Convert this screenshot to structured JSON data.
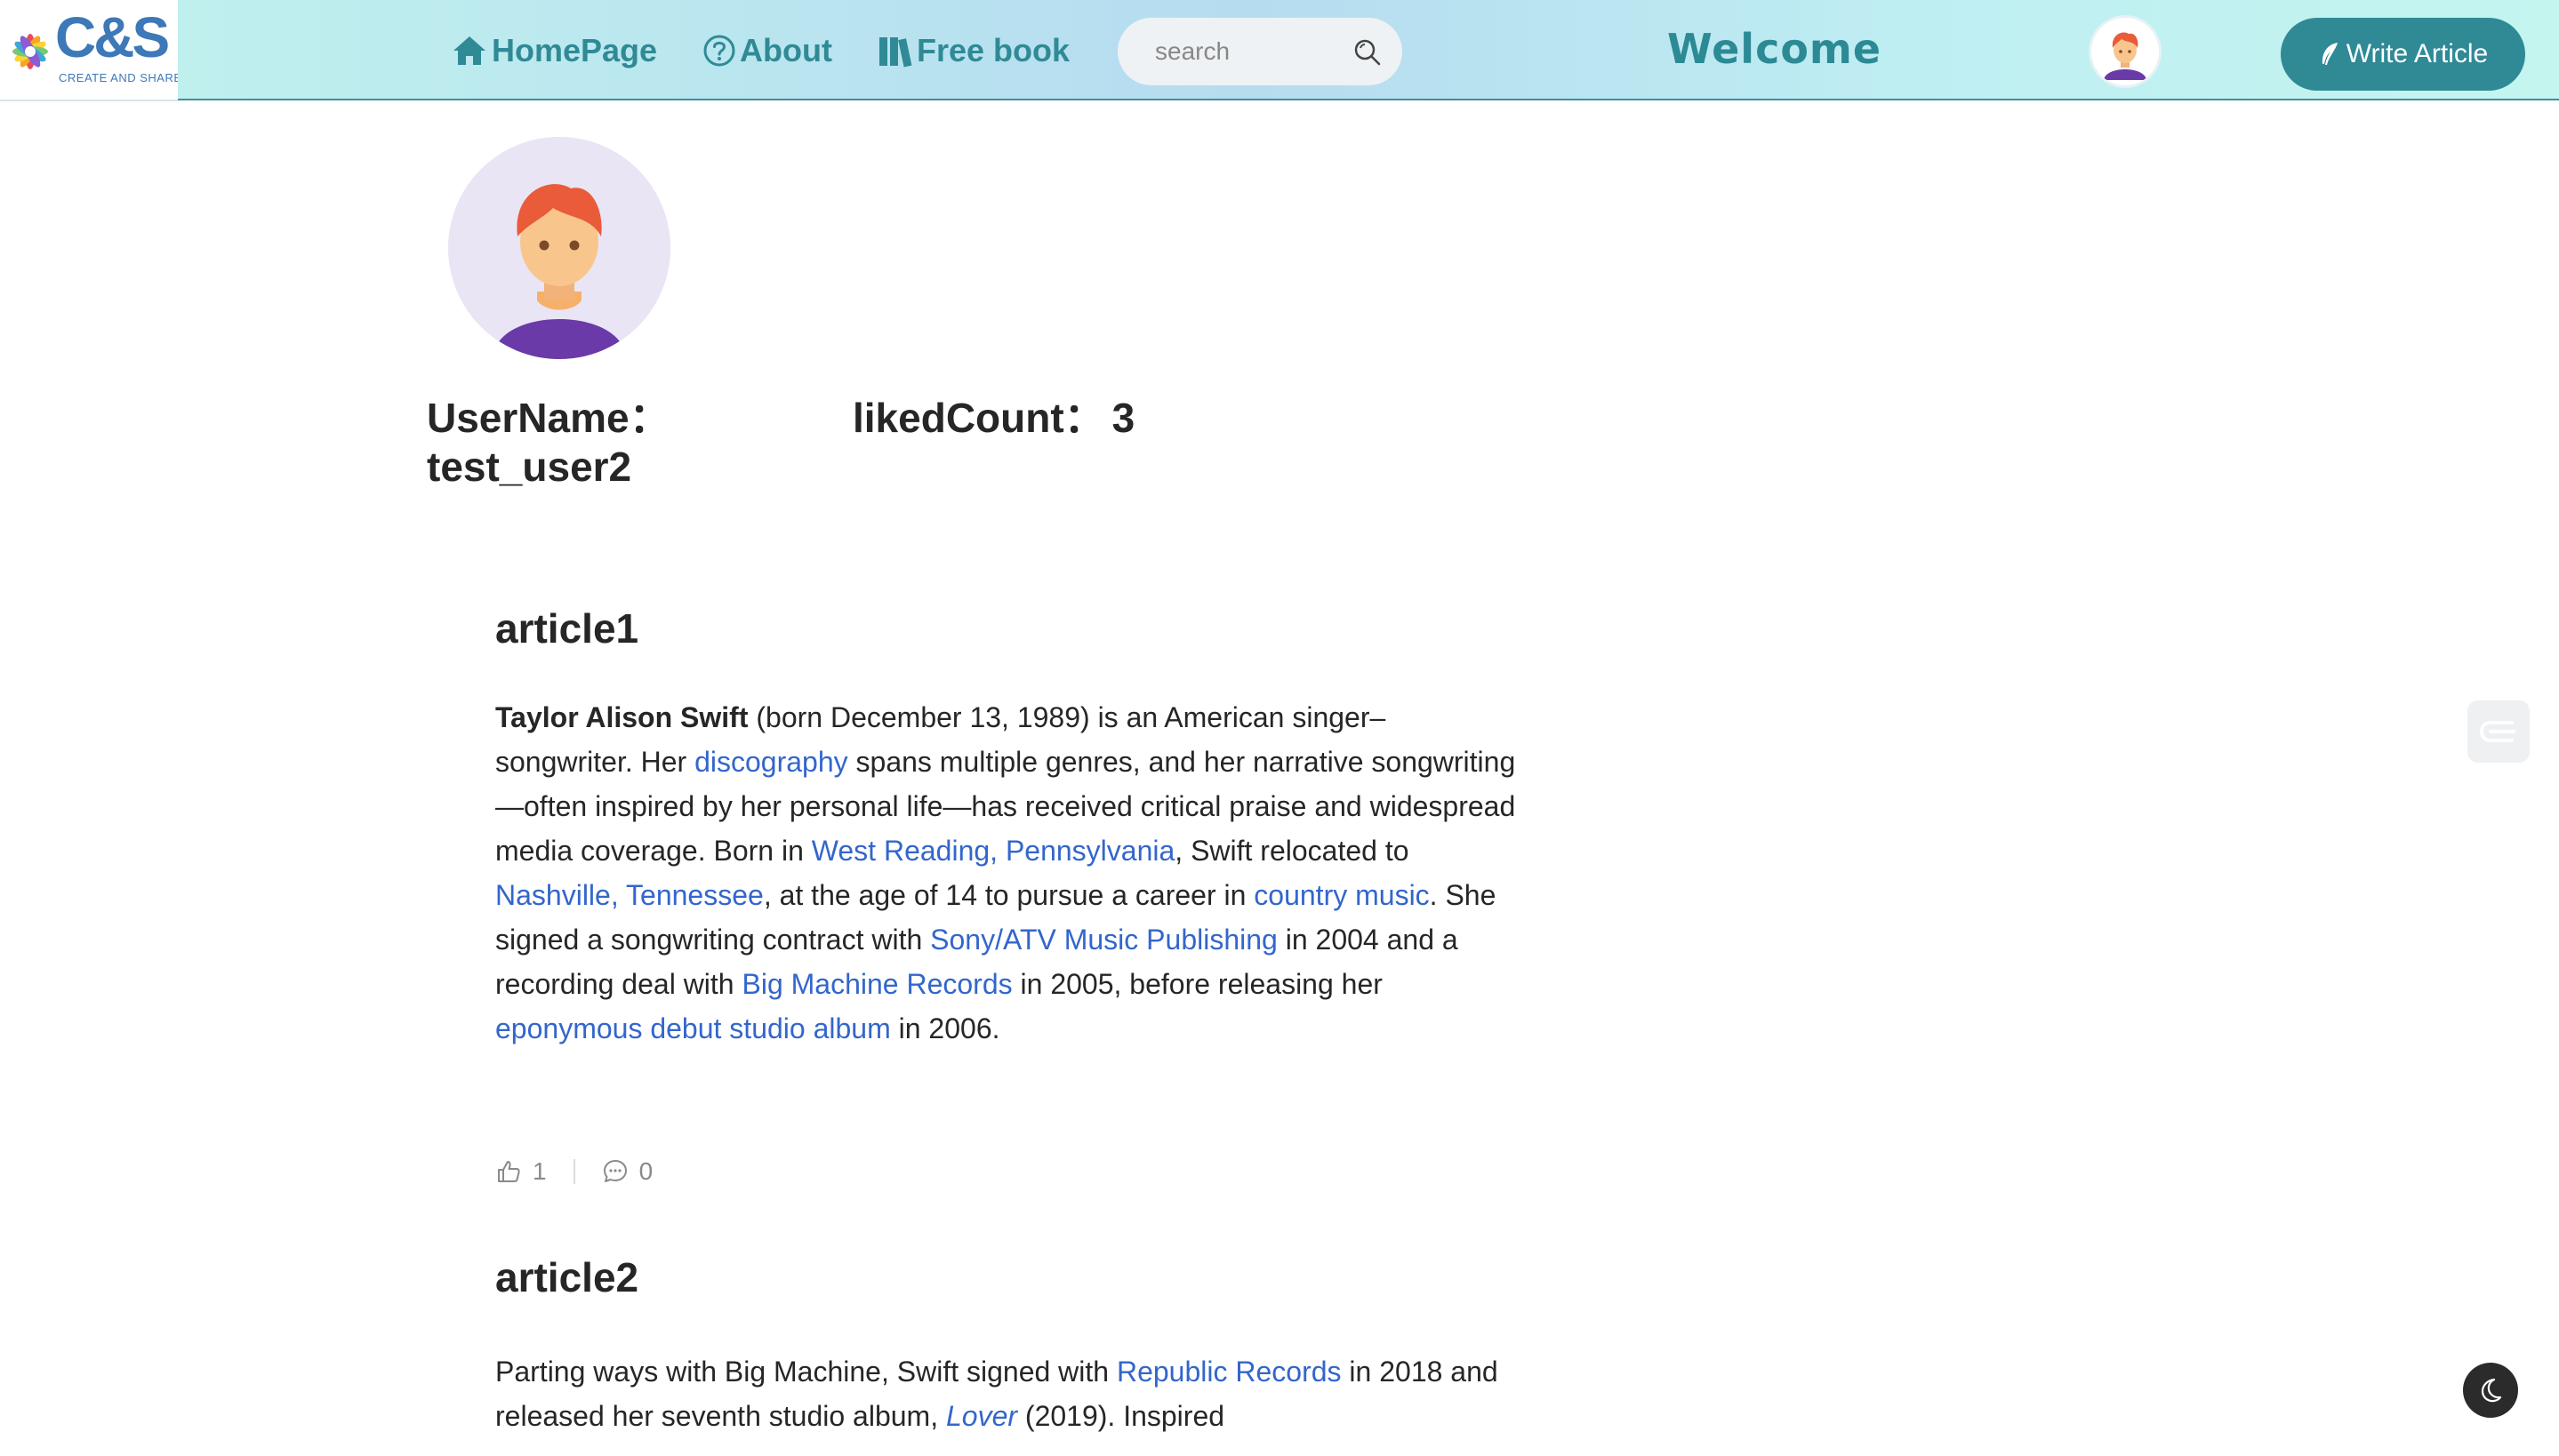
{
  "logo": {
    "text": "C&S",
    "subtitle": "CREATE AND SHARE"
  },
  "nav": {
    "home_label": "HomePage",
    "about_label": "About",
    "freebook_label": "Free book",
    "search_placeholder": "search",
    "welcome_text": "Welcome",
    "write_button_label": "Write Article"
  },
  "profile": {
    "username_label": "UserName：",
    "username_value": "test_user2",
    "liked_label": "likedCount：",
    "liked_value": "3"
  },
  "articles": [
    {
      "title": "article1",
      "body": {
        "name": "Taylor Alison Swift",
        "t1": " (born December 13, 1989) is an American singer–songwriter. Her ",
        "link1": "discography",
        "t2": " spans multiple genres, and her narrative songwriting—often inspired by her personal life—has received critical praise and widespread media coverage. Born in ",
        "link2": "West Reading, Pennsylvania",
        "t3": ", Swift relocated to ",
        "link3": "Nashville, Tennessee",
        "t4": ", at the age of 14 to pursue a career in ",
        "link4": "country music",
        "t5": ". She signed a songwriting contract with ",
        "link5": "Sony/ATV Music Publishing",
        "t6": " in 2004 and a recording deal with ",
        "link6": "Big Machine Records",
        "t7": " in 2005, before releasing her ",
        "link7": "eponymous debut studio album",
        "t8": " in 2006."
      },
      "likes": "1",
      "comments": "0"
    },
    {
      "title": "article2",
      "body": {
        "t1": "Parting ways with Big Machine, Swift signed with ",
        "link1": "Republic Records",
        "t2": " in 2018 and released her seventh studio album, ",
        "link2": "Lover",
        "t3": " (2019). Inspired"
      }
    }
  ],
  "colors": {
    "accent": "#2f8a96",
    "link": "#3366cc",
    "nav_gradient_start": "#bff0ee",
    "nav_gradient_mid": "#b6dcf0"
  },
  "icons": {
    "home": "home-icon",
    "about": "question-circle-icon",
    "freebook": "books-icon",
    "search": "search-icon",
    "write": "feather-icon",
    "like": "thumbs-up-icon",
    "comment": "comment-icon",
    "dark_mode": "moon-icon"
  }
}
